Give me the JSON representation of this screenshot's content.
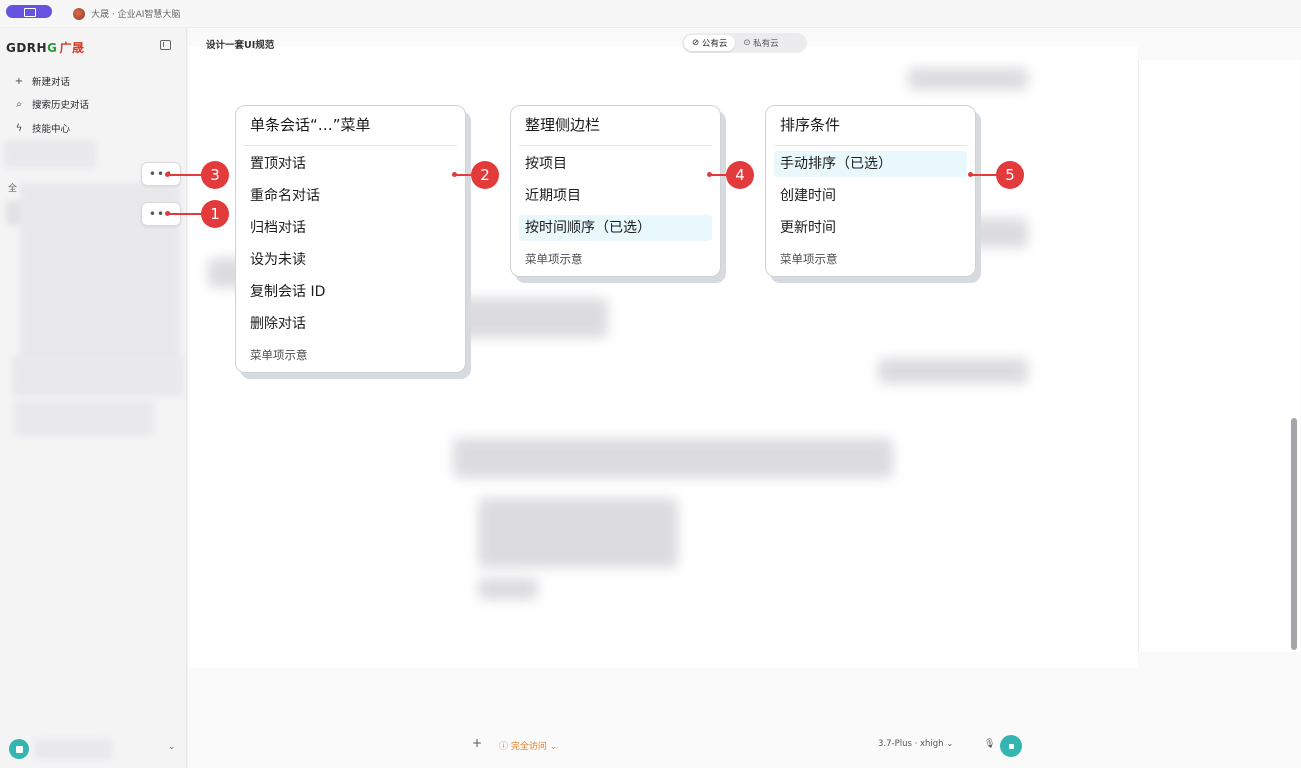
{
  "topbar": {
    "app_title": "大晟 · 企业AI智慧大脑"
  },
  "sidebar": {
    "brand_latin": "GDRH",
    "brand_ring": "G",
    "brand_cn": "广晟",
    "nav": [
      {
        "icon": "+",
        "label": "新建对话"
      },
      {
        "icon": "⌕",
        "label": "搜索历史对话"
      },
      {
        "icon": "ϟ",
        "label": "技能中心"
      }
    ],
    "section_label": "全",
    "more_glyph": "•••"
  },
  "main": {
    "chat_title": "设计一套UI规范",
    "segments": [
      {
        "icon": "⊘",
        "label": "公有云"
      },
      {
        "icon": "⊙",
        "label": "私有云"
      }
    ]
  },
  "composer": {
    "plus": "+",
    "access_label": "完全访问",
    "model_label": "3.7-Plus · xhigh",
    "mic": "🎙"
  },
  "menus": {
    "conversation": {
      "title": "单条会话“…”菜单",
      "items": [
        "置顶对话",
        "重命名对话",
        "归档对话",
        "设为未读",
        "复制会话 ID",
        "删除对话"
      ],
      "note": "菜单项示意"
    },
    "organize": {
      "title": "整理侧边栏",
      "items": [
        "按项目",
        "近期项目",
        "按时间顺序（已选）"
      ],
      "note": "菜单项示意"
    },
    "sort": {
      "title": "排序条件",
      "items": [
        "手动排序（已选）",
        "创建时间",
        "更新时间"
      ],
      "note": "菜单项示意"
    }
  },
  "badges": [
    "1",
    "2",
    "3",
    "4",
    "5"
  ],
  "colors": {
    "accent": "#6654e0",
    "badge": "#e33b3b",
    "selected_bg": "#e8f8fb",
    "teal": "#35b5b2",
    "warning": "#e37a25"
  }
}
